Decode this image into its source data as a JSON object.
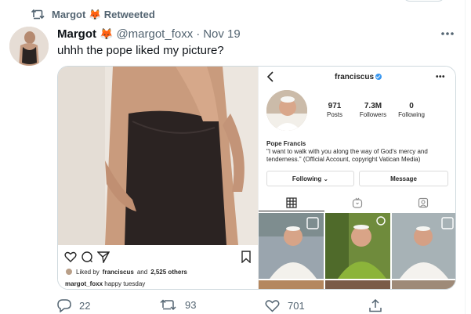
{
  "retweet_line": {
    "text": "Margot 🦊 Retweeted",
    "icon": "retweet-icon"
  },
  "tweet": {
    "author_name": "Margot",
    "author_emoji": "🦊",
    "handle": "@margot_foxx",
    "separator": "·",
    "date": "Nov 19",
    "text": "uhhh the pope liked my picture?",
    "more_icon": "more-dots-icon"
  },
  "instagram_post": {
    "likes_prefix": "Liked by",
    "likes_user": "franciscus",
    "likes_and": "and",
    "likes_others": "2,525 others",
    "caption_user": "margot_foxx",
    "caption_text": "happy tuesday",
    "icons": [
      "heart-icon",
      "comment-icon",
      "share-icon",
      "bookmark-icon"
    ]
  },
  "instagram_profile": {
    "username": "franciscus",
    "menu": "•••",
    "stats": [
      {
        "num": "971",
        "label": "Posts"
      },
      {
        "num": "7.3M",
        "label": "Followers"
      },
      {
        "num": "0",
        "label": "Following"
      }
    ],
    "bio_name": "Pope Francis",
    "bio_text": "\"I want to walk with you along the way of God's mercy and tenderness.\" (Official Account, copyright Vatican Media)",
    "following_button": "Following ⌄",
    "message_button": "Message",
    "tabs": [
      "grid-icon",
      "igtv-icon",
      "tagged-icon"
    ]
  },
  "actions": {
    "reply_count": "22",
    "retweet_count": "93",
    "like_count": "701"
  },
  "colors": {
    "muted": "#536471",
    "text": "#0f1419",
    "verified": "#3897f0",
    "retweet_green": "#536471"
  }
}
